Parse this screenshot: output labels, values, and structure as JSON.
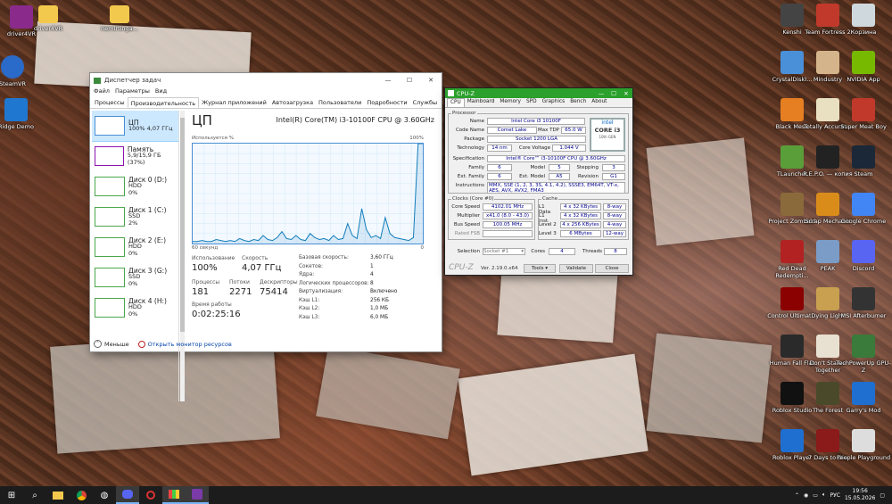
{
  "desktop_icons_left": [
    {
      "label": "driver4VR",
      "name": "driver4vr-archive-icon",
      "color": "#8a2a8a"
    },
    {
      "label": "driver4VR",
      "name": "folder-icon",
      "color": "#f2c94c"
    },
    {
      "label": "nemirtinga...",
      "name": "folder-icon",
      "color": "#f2c94c"
    },
    {
      "label": "SteamVR",
      "name": "steamvr-icon",
      "color": "#2a6ac8"
    },
    {
      "label": "Ridge Demo",
      "name": "ridge-demo-icon",
      "color": "#1f77d0"
    }
  ],
  "desktop_icons_right": [
    {
      "label": "Kenshi",
      "name": "kenshi-icon",
      "color": "#444"
    },
    {
      "label": "Team Fortress 2",
      "name": "team-fortress-icon",
      "color": "#c0392b"
    },
    {
      "label": "Корзина",
      "name": "recycle-bin-icon",
      "color": "#cfd8dc"
    },
    {
      "label": "CrystalDiskI...",
      "name": "crystaldiskinfo-icon",
      "color": "#4a90d9"
    },
    {
      "label": "Mindustry",
      "name": "mindustry-icon",
      "color": "#d4b48a"
    },
    {
      "label": "NVIDIA App",
      "name": "nvidia-icon",
      "color": "#76b900"
    },
    {
      "label": "Black Mesa",
      "name": "black-mesa-icon",
      "color": "#e67e22"
    },
    {
      "label": "Totally Accurat...",
      "name": "tabs-icon",
      "color": "#e8e0c0"
    },
    {
      "label": "Super Meat Boy",
      "name": "super-meat-boy-icon",
      "color": "#c0392b"
    },
    {
      "label": "TLauncher",
      "name": "tlauncher-icon",
      "color": "#5a9e3a"
    },
    {
      "label": "R.E.P.O. — копия",
      "name": "repo-icon",
      "color": "#222"
    },
    {
      "label": "Steam",
      "name": "steam-icon",
      "color": "#1b2838"
    },
    {
      "label": "Project Zomboid",
      "name": "project-zomboid-icon",
      "color": "#8a6a3a"
    },
    {
      "label": "Scrap Mechanic",
      "name": "scrap-mechanic-icon",
      "color": "#d98c1a"
    },
    {
      "label": "Google Chrome",
      "name": "chrome-icon",
      "color": "#4285f4"
    },
    {
      "label": "Red Dead Redempti...",
      "name": "rdr2-icon",
      "color": "#b22222"
    },
    {
      "label": "PEAK",
      "name": "peak-icon",
      "color": "#7a9cc6"
    },
    {
      "label": "Discord",
      "name": "discord-icon",
      "color": "#5865f2"
    },
    {
      "label": "Control Ultimat...",
      "name": "control-icon",
      "color": "#8b0000"
    },
    {
      "label": "Dying Light",
      "name": "dying-light-icon",
      "color": "#c8a050"
    },
    {
      "label": "MSI Afterburner",
      "name": "msi-afterburner-icon",
      "color": "#333"
    },
    {
      "label": "Human Fall Flat",
      "name": "human-fall-flat-icon",
      "color": "#2a2a2a"
    },
    {
      "label": "Don't Starve Together",
      "name": "dont-starve-icon",
      "color": "#e8e0d0"
    },
    {
      "label": "TechPowerUp GPU-Z",
      "name": "gpuz-icon",
      "color": "#3a7a3a"
    },
    {
      "label": "Roblox Studio",
      "name": "roblox-studio-icon",
      "color": "#111"
    },
    {
      "label": "The Forest",
      "name": "the-forest-icon",
      "color": "#4a4a2a"
    },
    {
      "label": "Garry's Mod",
      "name": "garrys-mod-icon",
      "color": "#1e6fd0"
    },
    {
      "label": "Roblox Player",
      "name": "roblox-icon",
      "color": "#1e6fd0"
    },
    {
      "label": "7 Days to Die",
      "name": "7-days-to-die-icon",
      "color": "#8b1a1a"
    },
    {
      "label": "People Playground",
      "name": "people-playground-icon",
      "color": "#ddd"
    }
  ],
  "taskmgr": {
    "title": "Диспетчер задач",
    "menu": [
      "Файл",
      "Параметры",
      "Вид"
    ],
    "tabs": [
      "Процессы",
      "Производительность",
      "Журнал приложений",
      "Автозагрузка",
      "Пользователи",
      "Подробности",
      "Службы"
    ],
    "side": [
      {
        "t1": "ЦП",
        "t2": "100% 4,07 ГГц",
        "t3": ""
      },
      {
        "t1": "Память",
        "t2": "5,9/15,9 ГБ (37%)",
        "t3": ""
      },
      {
        "t1": "Диск 0 (D:)",
        "t2": "HDD",
        "t3": "0%"
      },
      {
        "t1": "Диск 1 (C:)",
        "t2": "SSD",
        "t3": "2%"
      },
      {
        "t1": "Диск 2 (E:)",
        "t2": "HDD",
        "t3": "0%"
      },
      {
        "t1": "Диск 3 (G:)",
        "t2": "SSD",
        "t3": "0%"
      },
      {
        "t1": "Диск 4 (H:)",
        "t2": "HDD",
        "t3": "0%"
      }
    ],
    "cpu_title": "ЦП",
    "cpu_model": "Intel(R) Core(TM) i3-10100F CPU @ 3.60GHz",
    "graph_top_left": "Используется %",
    "graph_top_right": "100%",
    "graph_bottom_left": "60 секунд",
    "graph_bottom_right": "0",
    "utilization_label": "Использование",
    "utilization": "100%",
    "speed_label": "Скорость",
    "speed": "4,07 ГГц",
    "processes_label": "Процессы",
    "processes": "181",
    "threads_label": "Потоки",
    "threads": "2271",
    "handles_label": "Дескрипторы",
    "handles": "75414",
    "uptime_label": "Время работы",
    "uptime": "0:02:25:16",
    "details": [
      {
        "k": "Базовая скорость:",
        "v": "3,60 ГГц"
      },
      {
        "k": "Сокетов:",
        "v": "1"
      },
      {
        "k": "Ядра:",
        "v": "4"
      },
      {
        "k": "Логических процессоров:",
        "v": "8"
      },
      {
        "k": "Виртуализация:",
        "v": "Включено"
      },
      {
        "k": "Кэш L1:",
        "v": "256 КБ"
      },
      {
        "k": "Кэш L2:",
        "v": "1,0 МБ"
      },
      {
        "k": "Кэш L3:",
        "v": "6,0 МБ"
      }
    ],
    "fewer_details": "Меньше",
    "open_resmon": "Открыть монитор ресурсов",
    "cpu_history_percent": [
      2,
      2,
      3,
      2,
      2,
      4,
      3,
      2,
      3,
      2,
      5,
      3,
      2,
      4,
      3,
      8,
      4,
      3,
      6,
      12,
      5,
      4,
      8,
      4,
      3,
      10,
      6,
      4,
      5,
      3,
      8,
      4,
      5,
      20,
      8,
      5,
      35,
      14,
      6,
      8,
      5,
      26,
      10,
      6,
      5,
      4,
      3,
      6,
      100,
      100
    ]
  },
  "cpuz": {
    "title": "CPU-Z",
    "tabs": [
      "CPU",
      "Mainboard",
      "Memory",
      "SPD",
      "Graphics",
      "Bench",
      "About"
    ],
    "processor_group": "Processor",
    "name_lbl": "Name",
    "name": "Intel Core i3 10100F",
    "codename_lbl": "Code Name",
    "codename": "Comet Lake",
    "maxtdp_lbl": "Max TDP",
    "maxtdp": "65.0 W",
    "package_lbl": "Package",
    "package": "Socket 1200 LGA",
    "tech_lbl": "Technology",
    "tech": "14 nm",
    "corevolt_lbl": "Core Voltage",
    "corevolt": "1.044 V",
    "spec_lbl": "Specification",
    "spec": "Intel® Core™ i3-10100F CPU @ 3.60GHz",
    "family_lbl": "Family",
    "family": "6",
    "model_lbl": "Model",
    "model": "5",
    "stepping_lbl": "Stepping",
    "stepping": "3",
    "extfamily_lbl": "Ext. Family",
    "extfamily": "6",
    "extmodel_lbl": "Ext. Model",
    "extmodel": "A5",
    "revision_lbl": "Revision",
    "revision": "G1",
    "instr_lbl": "Instructions",
    "instr": "MMX, SSE (1, 2, 3, 3S, 4.1, 4.2), SSSE3, EM64T, VT-x, AES, AVX, AVX2, FMA3",
    "logo_line1": "intel",
    "logo_line2": "CORE i3",
    "logo_line3": "10th GEN",
    "clocks_group": "Clocks (Core #0)",
    "corespeed_lbl": "Core Speed",
    "corespeed": "4102.01 MHz",
    "mult_lbl": "Multiplier",
    "mult": "x41.0 (8.0 - 43.0)",
    "bus_lbl": "Bus Speed",
    "bus": "100.05 MHz",
    "fsb_lbl": "Rated FSB",
    "fsb": "",
    "cache_group": "Cache",
    "l1d_lbl": "L1 Data",
    "l1d": "4 x 32 KBytes",
    "l1d_w": "8-way",
    "l1i_lbl": "L1 Inst.",
    "l1i": "4 x 32 KBytes",
    "l1i_w": "8-way",
    "l2_lbl": "Level 2",
    "l2": "4 x 256 KBytes",
    "l2_w": "4-way",
    "l3_lbl": "Level 3",
    "l3": "6 MBytes",
    "l3_w": "12-way",
    "selection_lbl": "Selection",
    "selection": "Socket #1",
    "cores_lbl": "Cores",
    "cores": "4",
    "threads_lbl": "Threads",
    "threads": "8",
    "brand": "CPU-Z",
    "version": "Ver. 2.19.0.x64",
    "tools": "Tools",
    "validate": "Validate",
    "close": "Close"
  },
  "tray": {
    "lang": "РУС",
    "time": "19:56",
    "date": "15.05.2026"
  }
}
